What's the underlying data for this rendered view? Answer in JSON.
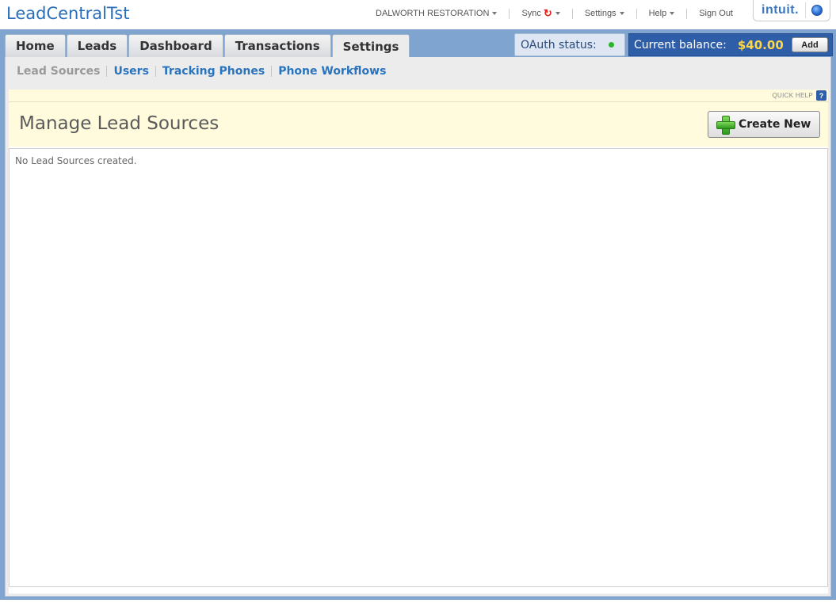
{
  "app": {
    "title": "LeadCentralTst"
  },
  "topnav": {
    "company": "DALWORTH RESTORATION",
    "sync": "Sync",
    "settings": "Settings",
    "help": "Help",
    "signout": "Sign Out",
    "logo": "intuit."
  },
  "tabs": [
    {
      "label": "Home"
    },
    {
      "label": "Leads"
    },
    {
      "label": "Dashboard"
    },
    {
      "label": "Transactions"
    },
    {
      "label": "Settings",
      "active": true
    }
  ],
  "oauth": {
    "label": "OAuth status:",
    "status_color": "#2bb52b"
  },
  "balance": {
    "label": "Current balance:",
    "amount": "$40.00",
    "add_label": "Add"
  },
  "subnav": [
    {
      "label": "Lead Sources",
      "current": true
    },
    {
      "label": "Users"
    },
    {
      "label": "Tracking Phones"
    },
    {
      "label": "Phone Workflows"
    }
  ],
  "quickhelp": {
    "label": "QUICK HELP",
    "icon": "?"
  },
  "page": {
    "title": "Manage Lead Sources",
    "create_label": "Create New",
    "empty_message": "No Lead Sources created."
  }
}
